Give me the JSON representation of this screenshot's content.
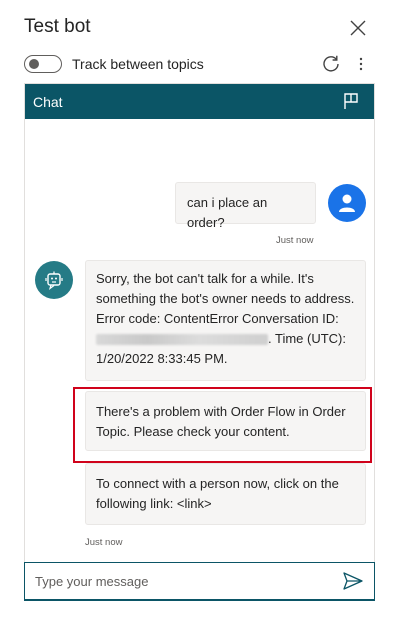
{
  "panel": {
    "title": "Test bot",
    "toggle_label": "Track between topics",
    "toggle_on": false
  },
  "chat": {
    "header_title": "Chat",
    "user_message": "can i place an order?",
    "user_timestamp": "Just now",
    "bot_message_1_part1": "Sorry, the bot can't talk for a while. It's something the bot's owner needs to address. Error code: ContentError  Conversation ID: ",
    "bot_message_1_part2": ". Time (UTC): 1/20/2022 8:33:45 PM.",
    "bot_message_2": "There's a problem with Order Flow in Order Topic. Please check your content.",
    "bot_message_3": "To connect with a person now, click on the following link: <link>",
    "bot_timestamp": "Just now"
  },
  "composer": {
    "placeholder": "Type your message"
  },
  "colors": {
    "header_bg": "#0b5566",
    "user_avatar": "#1a73e8",
    "bot_avatar": "#257b86",
    "highlight": "#d0021b"
  },
  "icons": [
    "close-icon",
    "refresh-icon",
    "more-vertical-icon",
    "flag-icon",
    "person-icon",
    "bot-icon",
    "send-icon"
  ]
}
